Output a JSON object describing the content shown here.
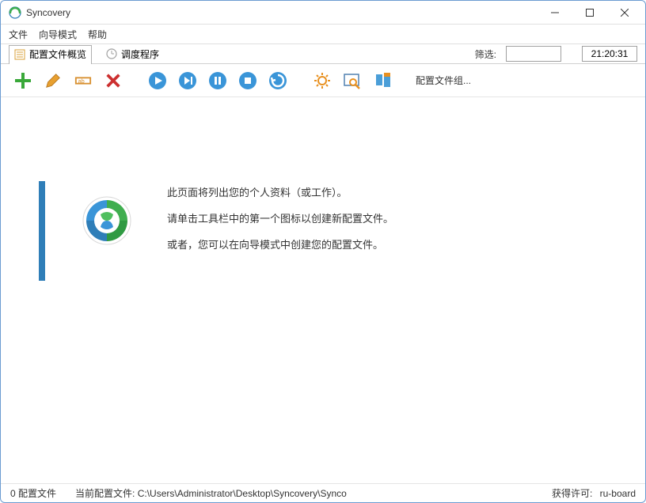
{
  "window": {
    "title": "Syncovery"
  },
  "menu": {
    "file": "文件",
    "wizard": "向导模式",
    "help": "帮助"
  },
  "tabs": {
    "overview": "配置文件概览",
    "scheduler": "调度程序"
  },
  "filter": {
    "label": "筛选:",
    "placeholder": ""
  },
  "clock": "21:20:31",
  "toolbar": {
    "group_label": "配置文件组..."
  },
  "welcome": {
    "line1": "此页面将列出您的个人资料（或工作）。",
    "line2": "请单击工具栏中的第一个图标以创建新配置文件。",
    "line3": "或者，您可以在向导模式中创建您的配置文件。"
  },
  "status": {
    "count": "0 配置文件",
    "current_label": "当前配置文件:",
    "current_path": "C:\\Users\\Administrator\\Desktop\\Syncovery\\Synco",
    "license_label": "获得许可:",
    "license_value": "ru-board"
  }
}
